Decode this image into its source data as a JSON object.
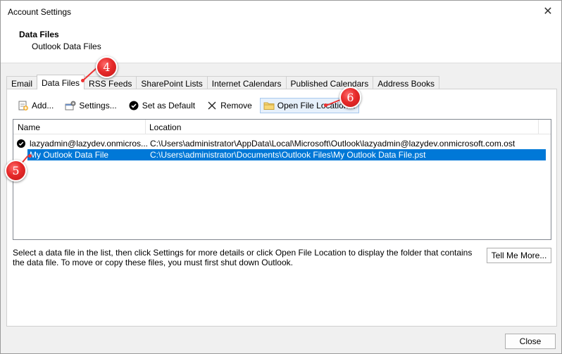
{
  "window": {
    "title": "Account Settings",
    "close_glyph": "✕"
  },
  "header": {
    "title": "Data Files",
    "subtitle": "Outlook Data Files"
  },
  "tabs": [
    {
      "label": "Email"
    },
    {
      "label": "Data Files",
      "active": true
    },
    {
      "label": "RSS Feeds"
    },
    {
      "label": "SharePoint Lists"
    },
    {
      "label": "Internet Calendars"
    },
    {
      "label": "Published Calendars"
    },
    {
      "label": "Address Books"
    }
  ],
  "toolbar": {
    "add_label": "Add...",
    "settings_label": "Settings...",
    "set_default_label": "Set as Default",
    "remove_label": "Remove",
    "open_location_label": "Open File Location..."
  },
  "list": {
    "columns": [
      "Name",
      "Location"
    ],
    "rows": [
      {
        "name": "lazyadmin@lazydev.onmicros...",
        "location": "C:\\Users\\administrator\\AppData\\Local\\Microsoft\\Outlook\\lazyadmin@lazydev.onmicrosoft.com.ost",
        "default": true,
        "selected": false
      },
      {
        "name": "My Outlook Data File",
        "location": "C:\\Users\\administrator\\Documents\\Outlook Files\\My Outlook Data File.pst",
        "default": false,
        "selected": true
      }
    ]
  },
  "info_text": "Select a data file in the list, then click Settings for more details or click Open File Location to display the folder that contains the data file. To move or copy these files, you must first shut down Outlook.",
  "tell_me_label": "Tell Me More...",
  "close_label": "Close",
  "callouts": [
    {
      "number": "4"
    },
    {
      "number": "5"
    },
    {
      "number": "6"
    }
  ],
  "colors": {
    "selection": "#0078d7",
    "callout": "#e62a2a",
    "highlight": "#e6f0fb"
  },
  "icons": [
    "close-icon",
    "add-file-icon",
    "settings-icon",
    "checkmark-icon",
    "remove-x-icon",
    "folder-icon"
  ]
}
